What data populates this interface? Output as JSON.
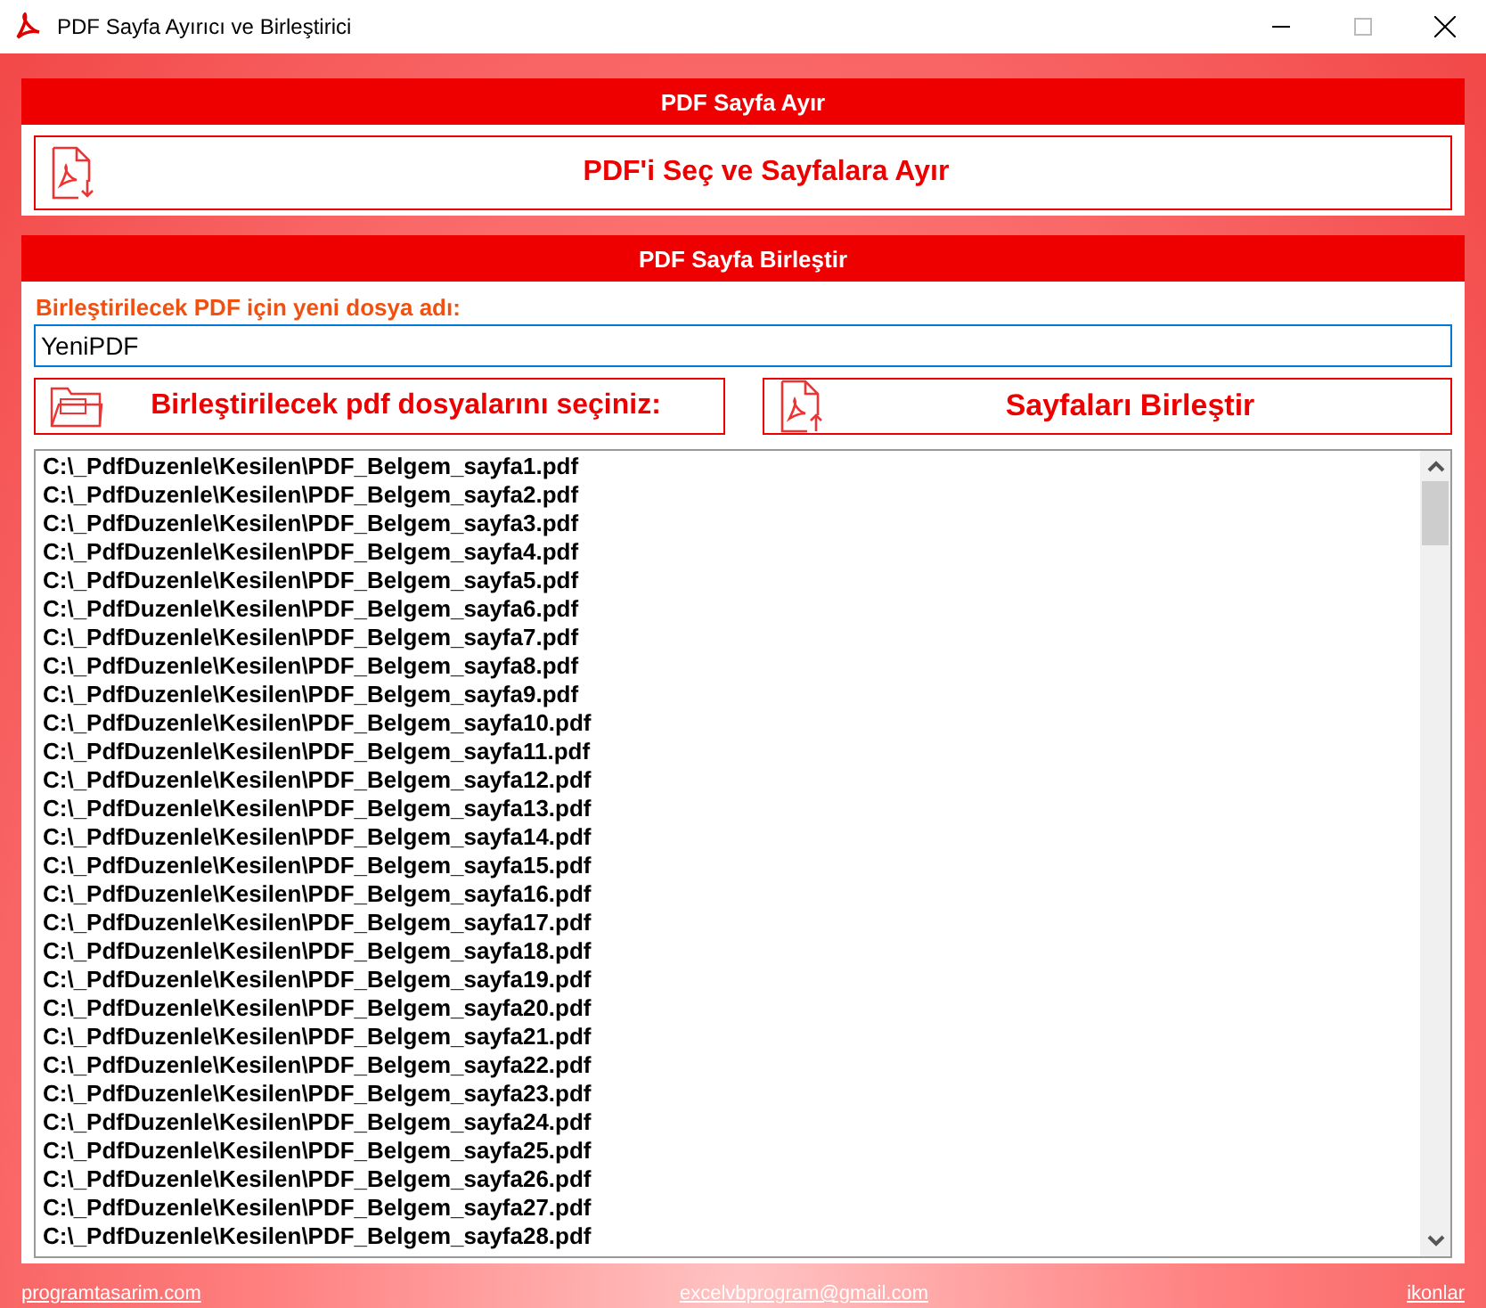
{
  "window": {
    "title": "PDF Sayfa Ayırıcı ve Birleştirici"
  },
  "split_panel": {
    "header": "PDF Sayfa Ayır",
    "button": "PDF'i Seç ve Sayfalara Ayır"
  },
  "merge_panel": {
    "header": "PDF Sayfa Birleştir",
    "filename_label": "Birleştirilecek PDF için yeni dosya adı:",
    "filename_value": "YeniPDF",
    "select_button": "Birleştirilecek pdf dosyalarını seçiniz:",
    "merge_button": "Sayfaları Birleştir",
    "files": [
      "C:\\_PdfDuzenle\\Kesilen\\PDF_Belgem_sayfa1.pdf",
      "C:\\_PdfDuzenle\\Kesilen\\PDF_Belgem_sayfa2.pdf",
      "C:\\_PdfDuzenle\\Kesilen\\PDF_Belgem_sayfa3.pdf",
      "C:\\_PdfDuzenle\\Kesilen\\PDF_Belgem_sayfa4.pdf",
      "C:\\_PdfDuzenle\\Kesilen\\PDF_Belgem_sayfa5.pdf",
      "C:\\_PdfDuzenle\\Kesilen\\PDF_Belgem_sayfa6.pdf",
      "C:\\_PdfDuzenle\\Kesilen\\PDF_Belgem_sayfa7.pdf",
      "C:\\_PdfDuzenle\\Kesilen\\PDF_Belgem_sayfa8.pdf",
      "C:\\_PdfDuzenle\\Kesilen\\PDF_Belgem_sayfa9.pdf",
      "C:\\_PdfDuzenle\\Kesilen\\PDF_Belgem_sayfa10.pdf",
      "C:\\_PdfDuzenle\\Kesilen\\PDF_Belgem_sayfa11.pdf",
      "C:\\_PdfDuzenle\\Kesilen\\PDF_Belgem_sayfa12.pdf",
      "C:\\_PdfDuzenle\\Kesilen\\PDF_Belgem_sayfa13.pdf",
      "C:\\_PdfDuzenle\\Kesilen\\PDF_Belgem_sayfa14.pdf",
      "C:\\_PdfDuzenle\\Kesilen\\PDF_Belgem_sayfa15.pdf",
      "C:\\_PdfDuzenle\\Kesilen\\PDF_Belgem_sayfa16.pdf",
      "C:\\_PdfDuzenle\\Kesilen\\PDF_Belgem_sayfa17.pdf",
      "C:\\_PdfDuzenle\\Kesilen\\PDF_Belgem_sayfa18.pdf",
      "C:\\_PdfDuzenle\\Kesilen\\PDF_Belgem_sayfa19.pdf",
      "C:\\_PdfDuzenle\\Kesilen\\PDF_Belgem_sayfa20.pdf",
      "C:\\_PdfDuzenle\\Kesilen\\PDF_Belgem_sayfa21.pdf",
      "C:\\_PdfDuzenle\\Kesilen\\PDF_Belgem_sayfa22.pdf",
      "C:\\_PdfDuzenle\\Kesilen\\PDF_Belgem_sayfa23.pdf",
      "C:\\_PdfDuzenle\\Kesilen\\PDF_Belgem_sayfa24.pdf",
      "C:\\_PdfDuzenle\\Kesilen\\PDF_Belgem_sayfa25.pdf",
      "C:\\_PdfDuzenle\\Kesilen\\PDF_Belgem_sayfa26.pdf",
      "C:\\_PdfDuzenle\\Kesilen\\PDF_Belgem_sayfa27.pdf",
      "C:\\_PdfDuzenle\\Kesilen\\PDF_Belgem_sayfa28.pdf"
    ]
  },
  "footer_links": [
    "programtasarim.com",
    "excelvbprogram@gmail.com",
    "ikonlar"
  ]
}
